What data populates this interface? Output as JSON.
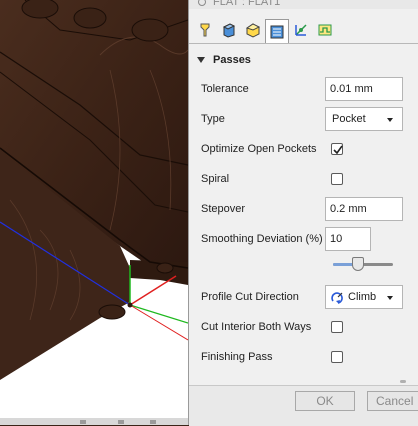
{
  "window": {
    "title": "FLAT : FLAT1"
  },
  "tabs": [
    {
      "name": "tool-tab",
      "icon": "tool-icon",
      "active": false
    },
    {
      "name": "geometry-tab",
      "icon": "geometry-icon",
      "active": false
    },
    {
      "name": "heights-tab",
      "icon": "heights-icon",
      "active": false
    },
    {
      "name": "passes-tab",
      "icon": "passes-icon",
      "active": true
    },
    {
      "name": "linking-tab",
      "icon": "linking-icon",
      "active": false
    },
    {
      "name": "shaft-holder-tab",
      "icon": "shaft-holder-icon",
      "active": false
    }
  ],
  "passes": {
    "section_title": "Passes",
    "tolerance": {
      "label": "Tolerance",
      "value": "0.01 mm"
    },
    "type": {
      "label": "Type",
      "value": "Pocket"
    },
    "optimize_open_pockets": {
      "label": "Optimize Open Pockets",
      "checked": true
    },
    "spiral": {
      "label": "Spiral",
      "checked": false
    },
    "stepover": {
      "label": "Stepover",
      "value": "0.2 mm"
    },
    "smoothing_deviation": {
      "label": "Smoothing Deviation (%)",
      "value": "10",
      "slider_fraction": 0.4
    },
    "profile_cut_direction": {
      "label": "Profile Cut Direction",
      "value": "Climb",
      "icon": "climb-icon"
    },
    "cut_interior_both_ways": {
      "label": "Cut Interior Both Ways",
      "checked": false
    },
    "finishing_pass": {
      "label": "Finishing Pass",
      "checked": false
    }
  },
  "footer": {
    "ok_label": "OK",
    "cancel_label": "Cancel"
  },
  "colors": {
    "model": "#3a2418",
    "accent": "#4a8fd8"
  }
}
